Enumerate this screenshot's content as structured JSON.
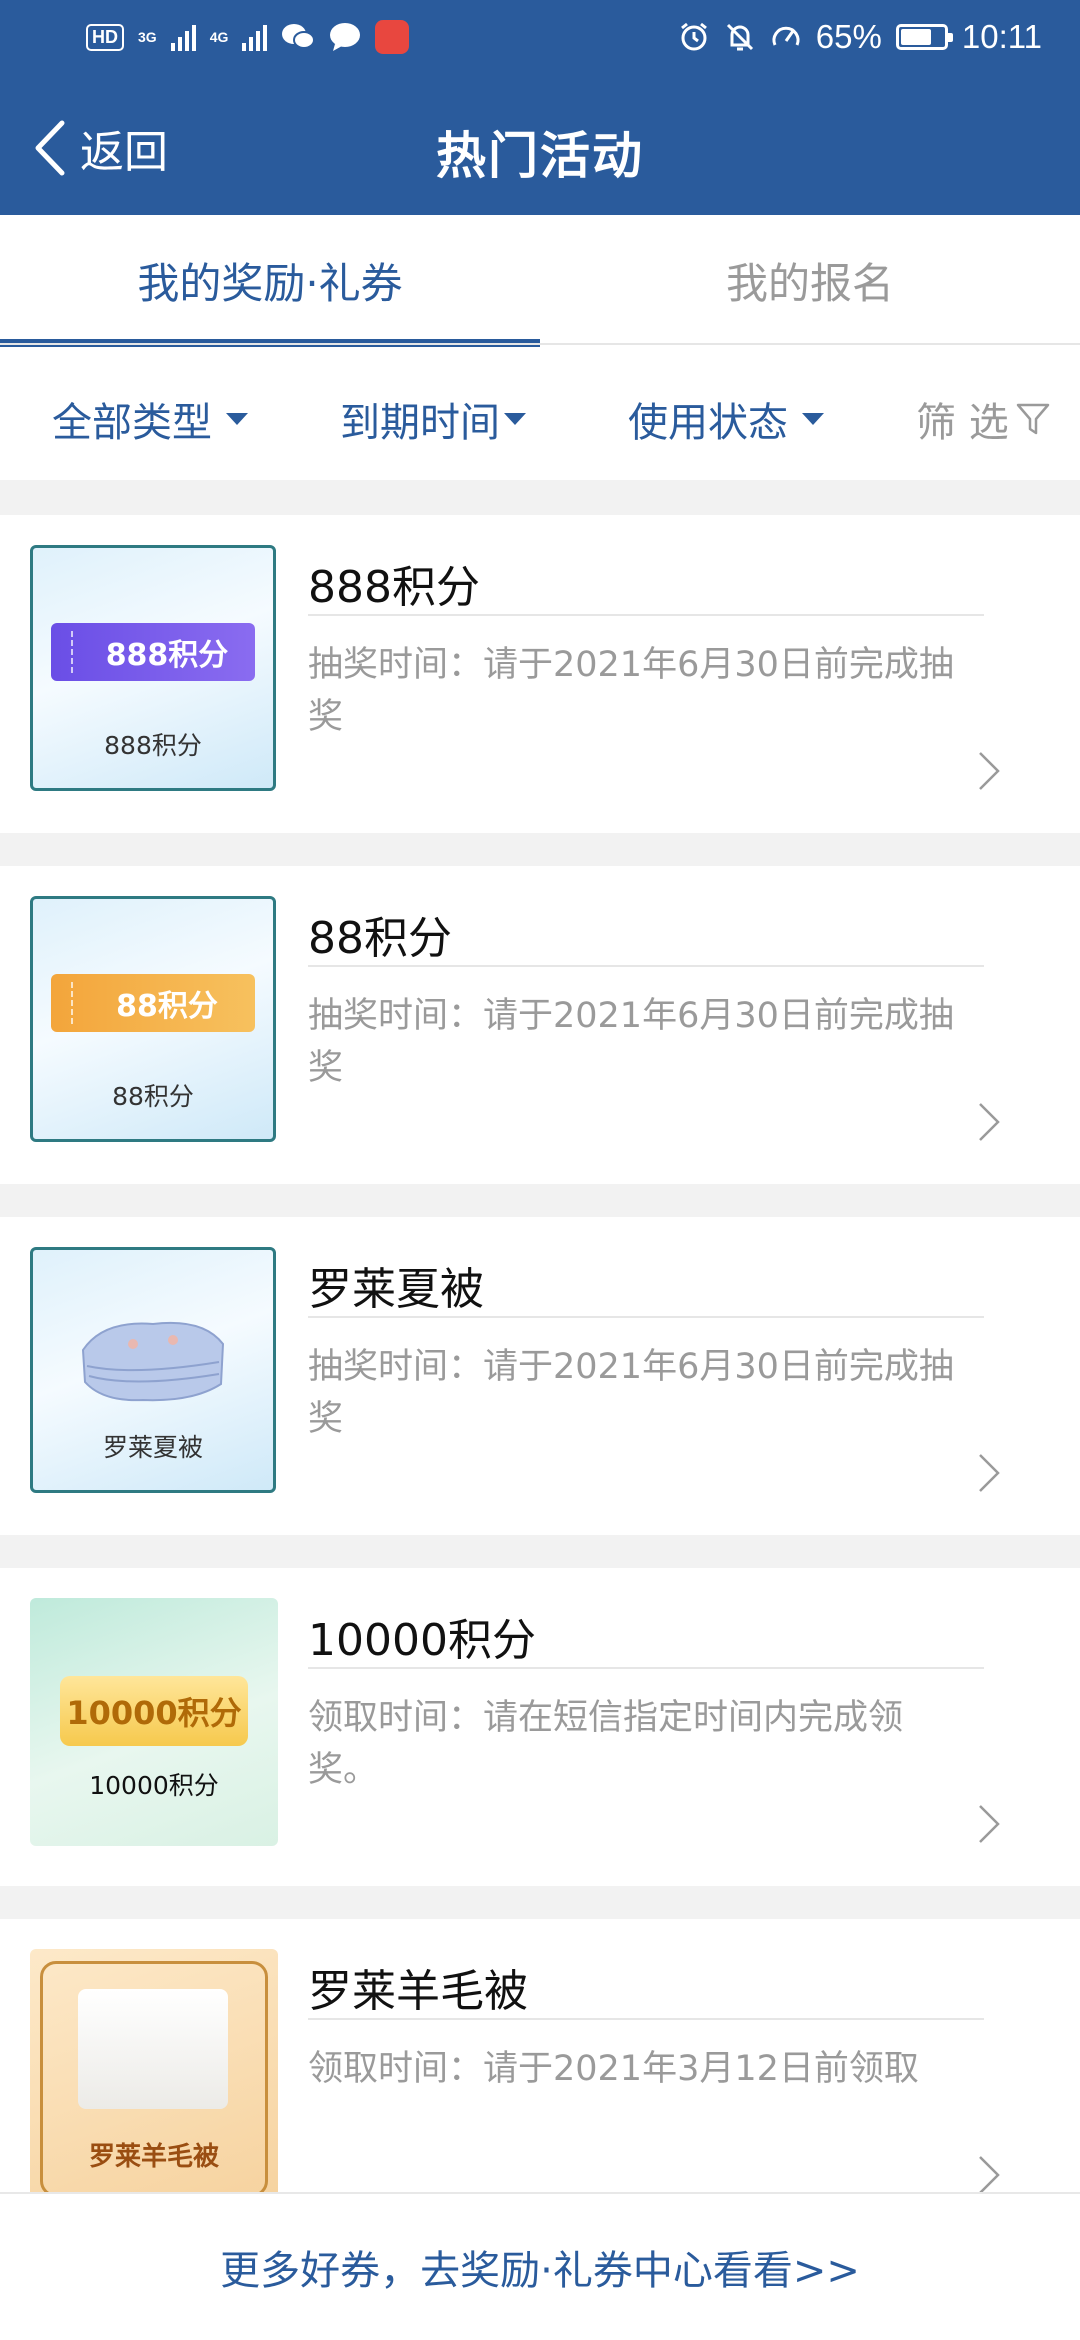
{
  "status_bar": {
    "hd": "HD",
    "net1": "3G",
    "net2": "4G",
    "battery_text": "65%",
    "battery_level": 0.65,
    "time": "10:11"
  },
  "header": {
    "back_label": "返回",
    "title": "热门活动"
  },
  "tabs": [
    {
      "label": "我的奖励·礼券",
      "active": true
    },
    {
      "label": "我的报名",
      "active": false
    }
  ],
  "filters": {
    "type": "全部类型",
    "expiry": "到期时间",
    "status": "使用状态",
    "filter": "筛 选"
  },
  "items": [
    {
      "name": "888积分",
      "desc": "抽奖时间：请于2021年6月30日前完成抽奖",
      "thumb_badge": "888积分",
      "thumb_caption": "888积分"
    },
    {
      "name": "88积分",
      "desc": "抽奖时间：请于2021年6月30日前完成抽奖",
      "thumb_badge": "88积分",
      "thumb_caption": "88积分"
    },
    {
      "name": "罗莱夏被",
      "desc": "抽奖时间：请于2021年6月30日前完成抽奖",
      "thumb_caption": "罗莱夏被"
    },
    {
      "name": "10000积分",
      "desc": "领取时间：请在短信指定时间内完成领奖。",
      "thumb_badge": "10000积分",
      "thumb_caption": "10000积分"
    },
    {
      "name": "罗莱羊毛被",
      "desc": "领取时间：请于2021年3月12日前领取",
      "thumb_caption": "罗莱羊毛被"
    }
  ],
  "bottom_link": "更多好券，去奖励·礼券中心看看>>",
  "colors": {
    "brand_blue": "#2a5b9c",
    "gray_text": "#9a9a9a"
  }
}
